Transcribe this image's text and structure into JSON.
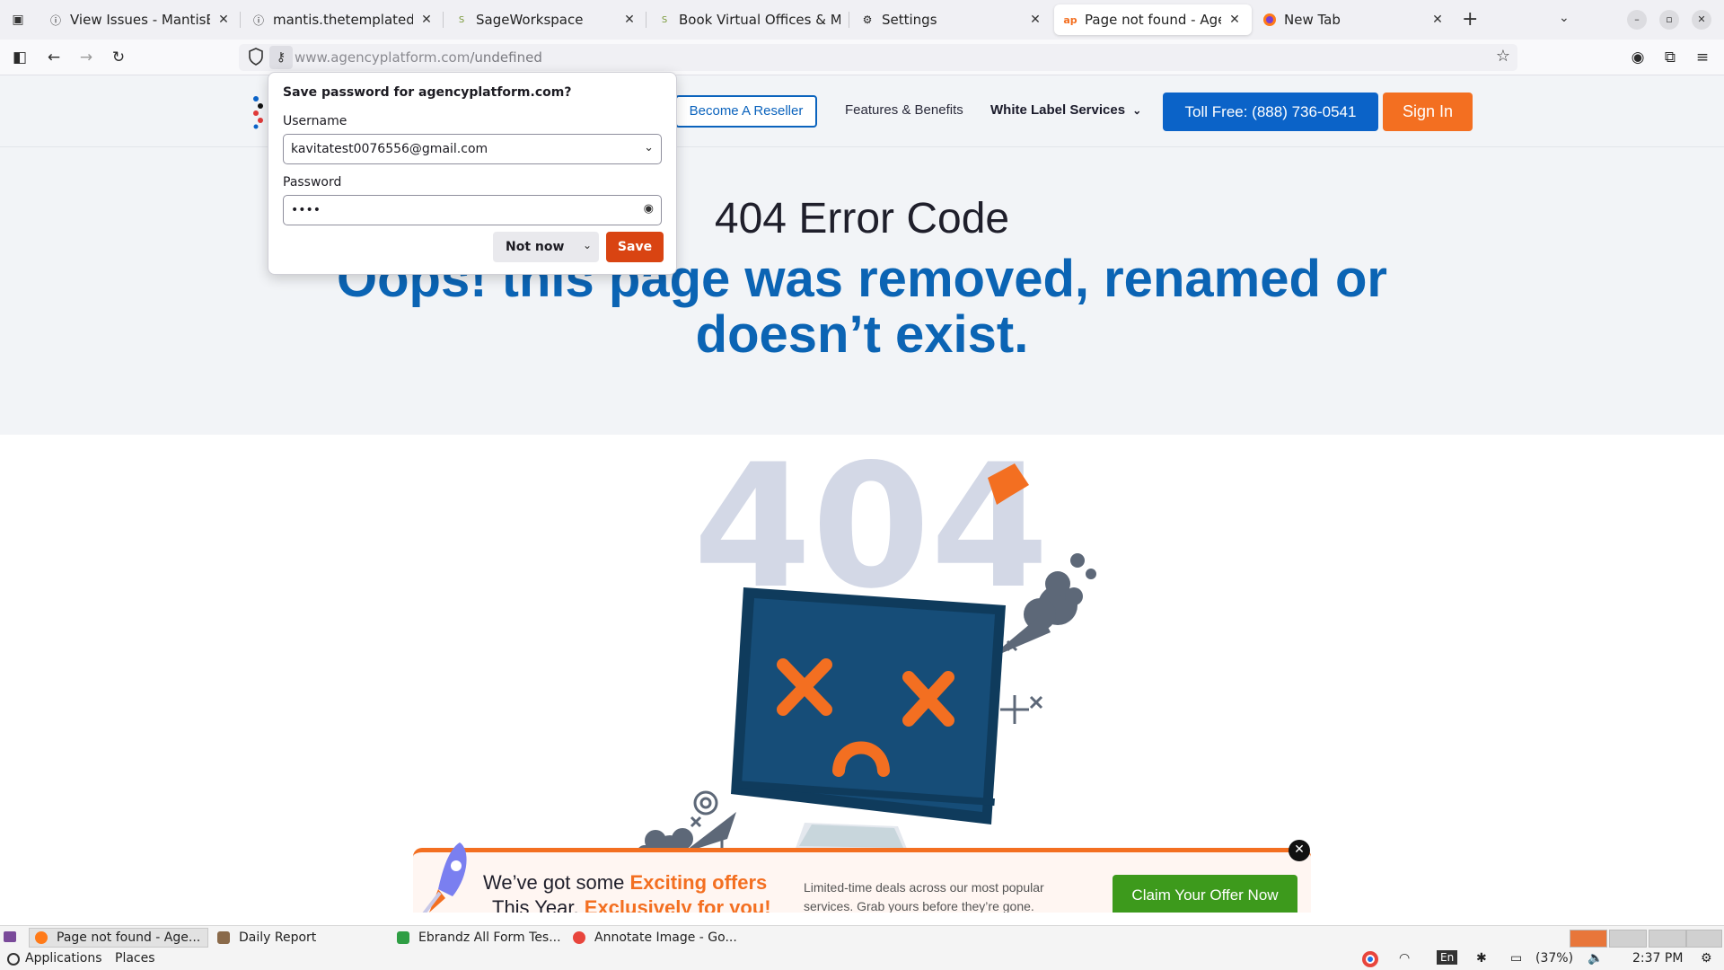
{
  "tabs": [
    {
      "title": "View Issues - MantisBT",
      "icon": "info-icon"
    },
    {
      "title": "mantis.thetemplatedemo",
      "icon": "info-icon"
    },
    {
      "title": "SageWorkspace",
      "icon": "sageworkspace-icon"
    },
    {
      "title": "Book Virtual Offices & Me",
      "icon": "sageworkspace-icon"
    },
    {
      "title": "Settings",
      "icon": "gear-icon"
    },
    {
      "title": "Page not found - AgencyP",
      "icon": "agencyplatform-icon",
      "active": true
    },
    {
      "title": "New Tab",
      "icon": "firefox-icon"
    }
  ],
  "url": {
    "host": "www.agencyplatform.com",
    "path": "/undefined"
  },
  "site_nav": {
    "reseller": "Become A Reseller",
    "features": "Features & Benefits",
    "white_label": "White Label Services",
    "toll_free": "Toll Free: (888) 736-0541",
    "sign_in": "Sign In"
  },
  "hero": {
    "code": "404 Error Code",
    "message": "Oops! this page was removed, renamed or doesn’t exist."
  },
  "illustration": {
    "big_text": "404"
  },
  "promo": {
    "line1_pre": "We’ve got some ",
    "line1_hl": "Exciting offers",
    "line2_pre": "This Year, ",
    "line2_hl": "Exclusively for you!",
    "desc": "Limited-time deals across our most popular services. Grab yours before they’re gone.",
    "cta": "Claim Your Offer Now"
  },
  "password_prompt": {
    "title": "Save password for agencyplatform.com?",
    "username_label": "Username",
    "username_value": "kavitatest0076556@gmail.com",
    "password_label": "Password",
    "password_value": "••••",
    "not_now": "Not now",
    "save": "Save"
  },
  "taskbar": {
    "tasks": [
      {
        "label": "Page not found - Age...",
        "active": true
      },
      {
        "label": "Daily Report",
        "active": false
      },
      {
        "label": "Ebrandz All Form Tes...",
        "active": false
      },
      {
        "label": "Annotate Image - Go...",
        "active": false
      }
    ]
  },
  "panel": {
    "applications": "Applications",
    "places": "Places",
    "keyboard": "En",
    "battery": "(37%)",
    "time": "2:37 PM"
  },
  "colors": {
    "brand_blue": "#0b63c8",
    "brand_orange": "#f36f21",
    "headline_blue": "#0b64b4",
    "save_button": "#d94412",
    "cta_green": "#3d9a1c"
  }
}
